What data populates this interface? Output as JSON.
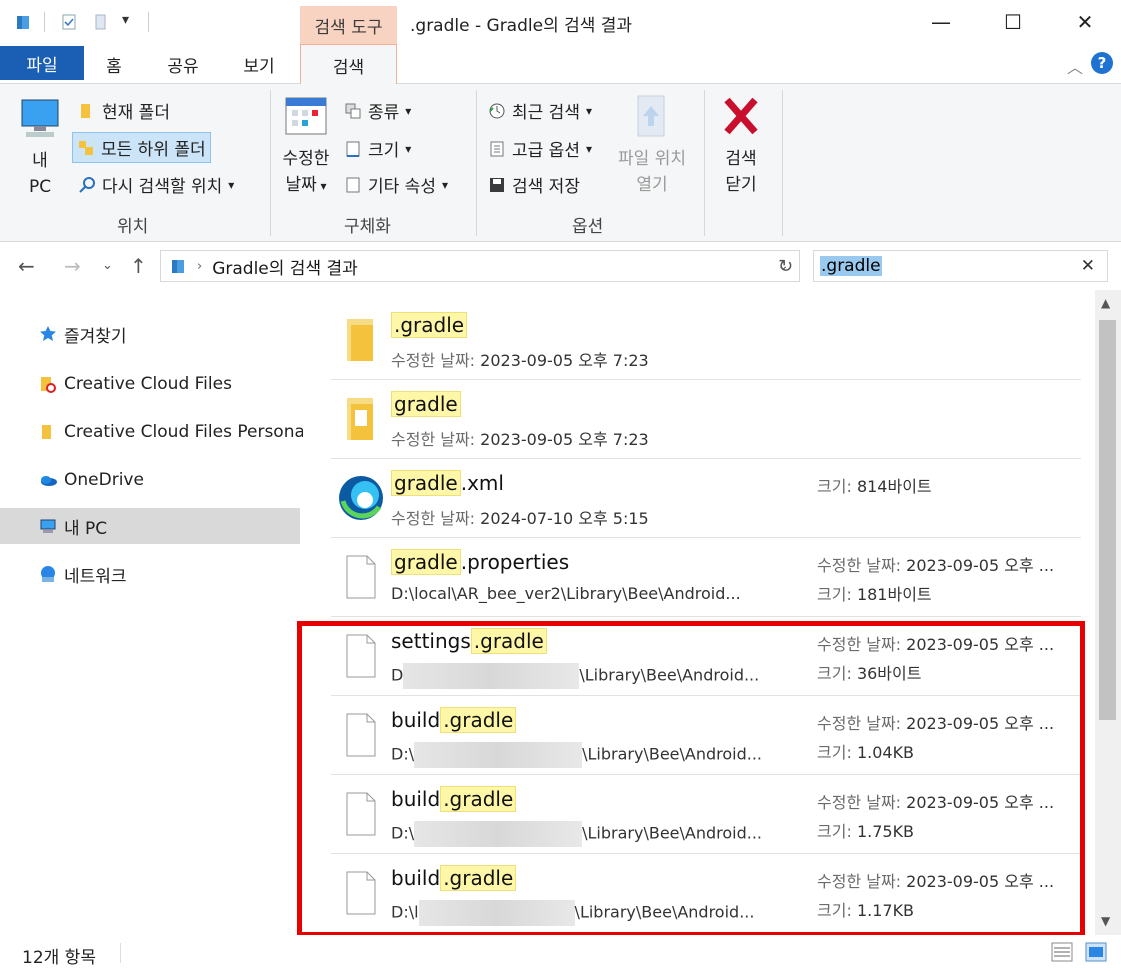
{
  "window": {
    "context_tab": "검색 도구",
    "title": ".gradle - Gradle의 검색 결과",
    "minimize": "—",
    "maximize": "☐",
    "close": "✕"
  },
  "tabs": {
    "file": "파일",
    "home": "홈",
    "share": "공유",
    "view": "보기",
    "search": "검색"
  },
  "ribbon": {
    "location": {
      "this_pc_line1": "내",
      "this_pc_line2": "PC",
      "current_folder": "현재 폴더",
      "all_subfolders": "모든 하위 폴더",
      "search_again": "다시 검색할 위치",
      "label": "위치"
    },
    "refine": {
      "date_modified_line1": "수정한",
      "date_modified_line2": "날짜",
      "kind": "종류",
      "size": "크기",
      "other_properties": "기타 속성",
      "label": "구체화"
    },
    "options": {
      "recent_searches": "최근 검색",
      "advanced_options": "고급 옵션",
      "save_search": "검색 저장",
      "open_file_location_line1": "파일 위치",
      "open_file_location_line2": "열기",
      "label": "옵션"
    },
    "close_search_line1": "검색",
    "close_search_line2": "닫기"
  },
  "address": {
    "path": "Gradle의 검색 결과",
    "search_query": ".gradle"
  },
  "nav": {
    "items": [
      "즐겨찾기",
      "Creative Cloud Files",
      "Creative Cloud Files Personal",
      "OneDrive",
      "내 PC",
      "네트워크"
    ]
  },
  "results": [
    {
      "name_hl": ".gradle",
      "name_rest": "",
      "sub_label": "수정한 날짜:",
      "sub_value": "2023-09-05 오후 7:23",
      "r1_label": "",
      "r1_value": "",
      "r2_label": "",
      "r2_value": ""
    },
    {
      "name_hl": "gradle",
      "name_rest": "",
      "sub_label": "수정한 날짜:",
      "sub_value": "2023-09-05 오후 7:23",
      "r1_label": "",
      "r1_value": "",
      "r2_label": "",
      "r2_value": ""
    },
    {
      "name_hl": "gradle",
      "name_rest": ".xml",
      "sub_label": "수정한 날짜:",
      "sub_value": "2024-07-10 오후 5:15",
      "r1_label": "크기:",
      "r1_value": "814바이트",
      "r2_label": "",
      "r2_value": ""
    },
    {
      "name_hl": "gradle",
      "name_rest": ".properties",
      "path": "D:\\local\\AR_bee_ver2\\Library\\Bee\\Android...",
      "r1_label": "수정한 날짜:",
      "r1_value": "2023-09-05 오후 ...",
      "r2_label": "크기:",
      "r2_value": "181바이트"
    },
    {
      "name_pre": "settings",
      "name_hl": ".gradle",
      "path_pre": "D",
      "path_post": "\\Library\\Bee\\Android...",
      "r1_label": "수정한 날짜:",
      "r1_value": "2023-09-05 오후 ...",
      "r2_label": "크기:",
      "r2_value": "36바이트"
    },
    {
      "name_pre": "build",
      "name_hl": ".gradle",
      "path_pre": "D:\\",
      "path_post": "\\Library\\Bee\\Android...",
      "r1_label": "수정한 날짜:",
      "r1_value": "2023-09-05 오후 ...",
      "r2_label": "크기:",
      "r2_value": "1.04KB"
    },
    {
      "name_pre": "build",
      "name_hl": ".gradle",
      "path_pre": "D:\\",
      "path_post": "\\Library\\Bee\\Android...",
      "r1_label": "수정한 날짜:",
      "r1_value": "2023-09-05 오후 ...",
      "r2_label": "크기:",
      "r2_value": "1.75KB"
    },
    {
      "name_pre": "build",
      "name_hl": ".gradle",
      "path_pre": "D:\\l",
      "path_post": "\\Library\\Bee\\Android...",
      "r1_label": "수정한 날짜:",
      "r1_value": "2023-09-05 오후 ...",
      "r2_label": "크기:",
      "r2_value": "1.17KB"
    }
  ],
  "status": {
    "count": "12개 항목"
  },
  "colors": {
    "file_tab": "#1a5fb4",
    "context_tab": "#f9d3c2",
    "highlight": "#fff7a8",
    "annotation_box": "#e60000"
  }
}
